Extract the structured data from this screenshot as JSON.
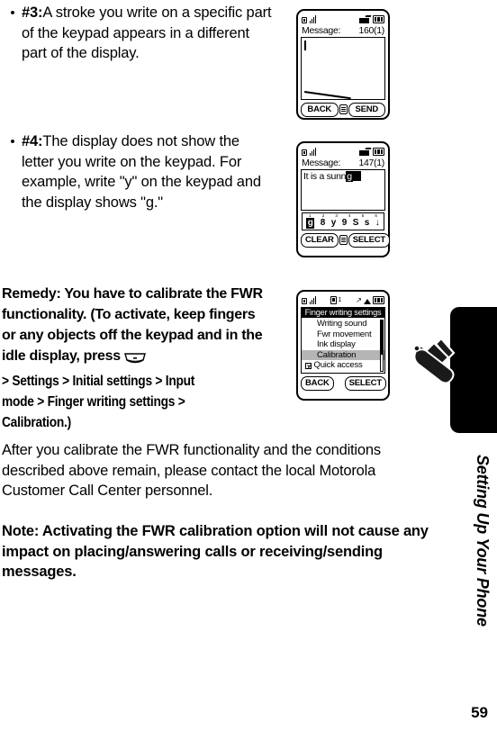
{
  "body": {
    "bullets": [
      {
        "marker": "#3:",
        "text": "A stroke you write on a specific part of the keypad appears in a different part of the display."
      },
      {
        "marker": "#4:",
        "text": "The display does not show the letter you write on the keypad. For example, write \"y\" on the keypad and the display shows \"g.\""
      }
    ],
    "remedy": {
      "lead": "Remedy: You have to calibrate the FWR functionality. (To activate, keep fingers or any objects off the keypad and in the idle display, press",
      "path": "> Settings > Initial settings > Input mode > Finger writing settings > Calibration.)",
      "menu_key_icon": "menu-key-icon"
    },
    "paragraph_after": "After you calibrate the FWR functionality and the conditions described above remain, please contact the local Motorola Customer Call Center personnel.",
    "note": "Note: Activating the FWR calibration option will not cause any impact on placing/answering calls or receiving/sending messages."
  },
  "phone1": {
    "status": {
      "signal_icon": "signal-bars-icon",
      "message_icon": "envelope-icon",
      "battery_icon": "battery-icon"
    },
    "header_label": "Message:",
    "header_count": "160(1)",
    "screen": {
      "caret": "text-caret",
      "stroke": "handwriting-stroke"
    },
    "softkeys": {
      "left": "BACK",
      "center_icon": "menu-icon",
      "right": "SEND"
    }
  },
  "phone2": {
    "status": {
      "signal_icon": "signal-bars-icon",
      "message_icon": "envelope-icon",
      "battery_icon": "battery-icon"
    },
    "header_label": "Message:",
    "header_count": "147(1)",
    "typed_text": "It is a sunn",
    "typed_highlight": "g",
    "candidates": {
      "numbers": [
        "1",
        "2",
        "3",
        "4",
        "5",
        "6"
      ],
      "items": [
        "g",
        "8",
        "y",
        "9",
        "S",
        "s"
      ],
      "selected_index": 0,
      "more_arrow": "↓"
    },
    "softkeys": {
      "left": "CLEAR",
      "center_icon": "menu-icon",
      "right": "SELECT"
    }
  },
  "phone3": {
    "status": {
      "signal_icon": "signal-bars-icon",
      "sim_icon": "sim-1-icon",
      "sim_label": "1",
      "vibrate_icon": "vibrate-icon",
      "alarm_icon": "alarm-icon",
      "battery_icon": "battery-icon"
    },
    "menu_title": "Finger writing settings",
    "menu_items": [
      {
        "label": "Writing sound",
        "selected": false,
        "checkbox": false
      },
      {
        "label": "Fwr movement",
        "selected": false,
        "checkbox": false
      },
      {
        "label": "Ink display",
        "selected": false,
        "checkbox": false
      },
      {
        "label": "Calibration",
        "selected": true,
        "checkbox": false
      },
      {
        "label": "Quick access",
        "selected": false,
        "checkbox": true
      }
    ],
    "softkeys": {
      "left": "BACK",
      "right": "SELECT"
    }
  },
  "sidebar": {
    "chapter_label": "Setting Up Your Phone",
    "tool_icon": "wrench-screwdriver-icon",
    "page_number": "59"
  }
}
